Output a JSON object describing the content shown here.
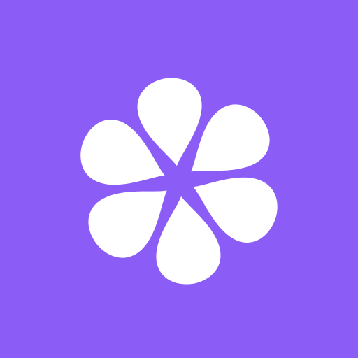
{
  "app_icon": {
    "icon": "six-petal-flower-icon",
    "background_color": "#8b5cf6",
    "petal_color": "#ffffff",
    "petal_count": 6
  }
}
